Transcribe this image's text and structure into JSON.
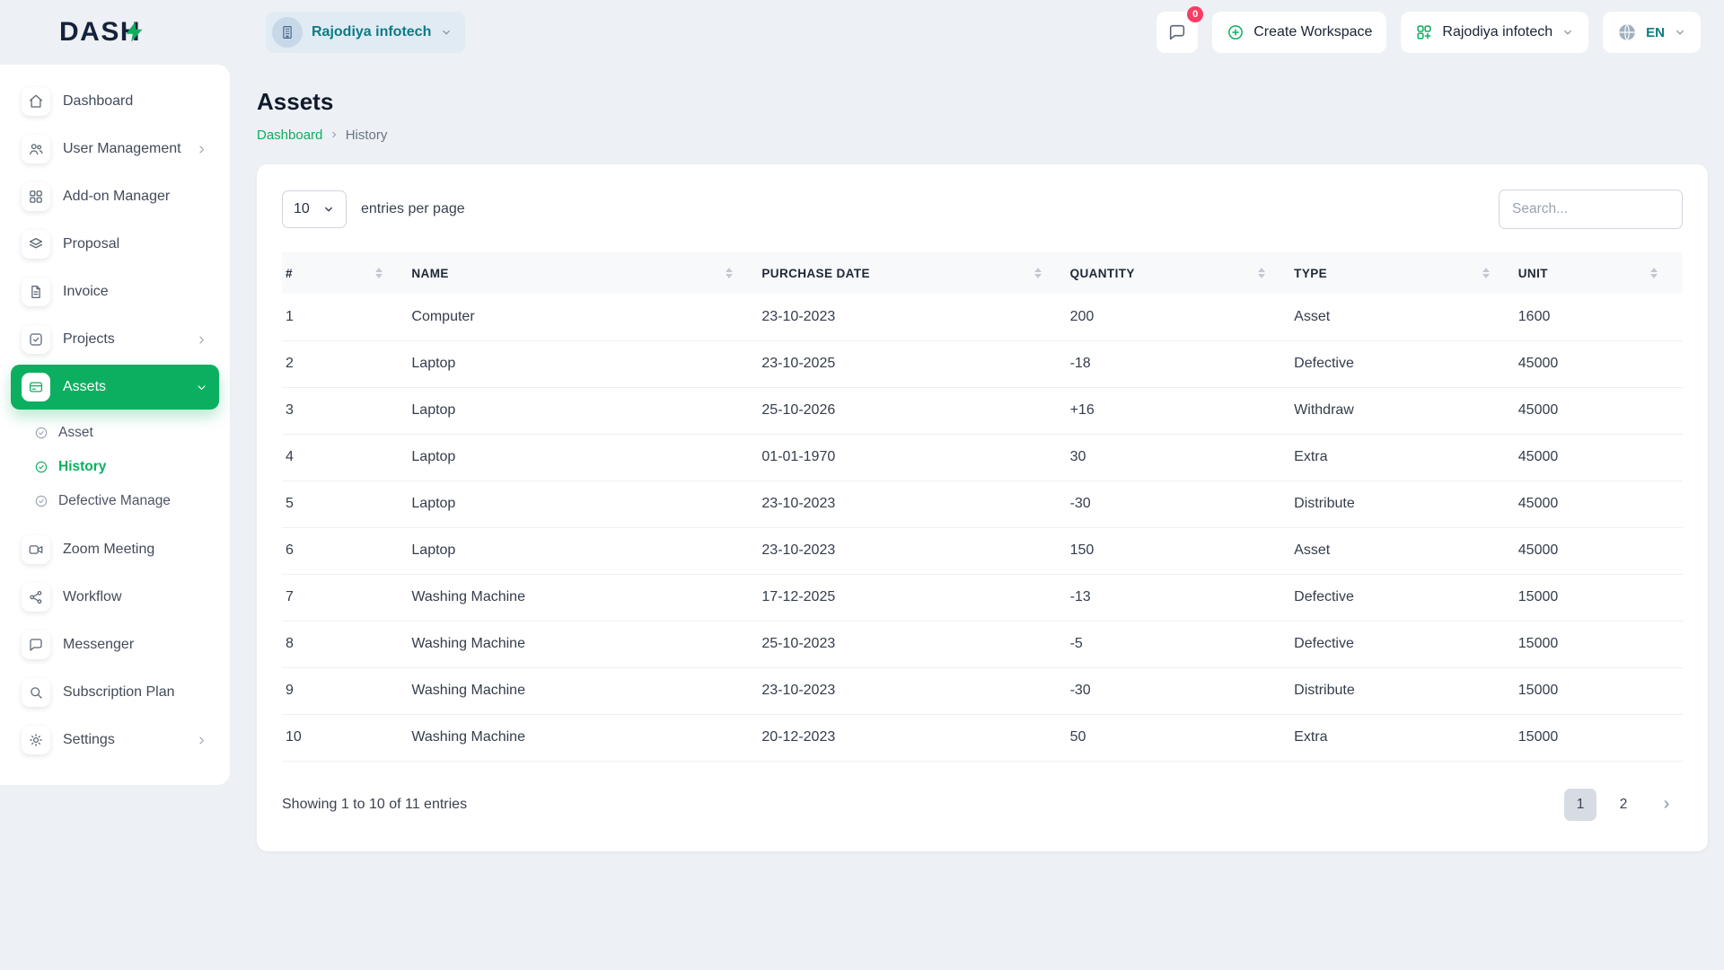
{
  "brand": {
    "name": "DASH"
  },
  "topbar": {
    "workspace_pill": "Rajodiya infotech",
    "chat_badge": "0",
    "create_workspace": "Create Workspace",
    "workspace_dropdown": "Rajodiya infotech",
    "language": "EN"
  },
  "sidebar": {
    "items": [
      {
        "label": "Dashboard",
        "icon": "home"
      },
      {
        "label": "User Management",
        "icon": "users",
        "chevron": true
      },
      {
        "label": "Add-on Manager",
        "icon": "grid"
      },
      {
        "label": "Proposal",
        "icon": "layers"
      },
      {
        "label": "Invoice",
        "icon": "file"
      },
      {
        "label": "Projects",
        "icon": "check-square",
        "chevron": true
      },
      {
        "label": "Assets",
        "icon": "credit-card",
        "active": true,
        "expanded": true,
        "children": [
          {
            "label": "Asset"
          },
          {
            "label": "History",
            "active": true
          },
          {
            "label": "Defective Manage"
          }
        ]
      },
      {
        "label": "Zoom Meeting",
        "icon": "video-camera"
      },
      {
        "label": "Workflow",
        "icon": "share-nodes"
      },
      {
        "label": "Messenger",
        "icon": "chat-bubble"
      },
      {
        "label": "Subscription Plan",
        "icon": "magnifier"
      },
      {
        "label": "Settings",
        "icon": "gear",
        "chevron": true
      }
    ]
  },
  "page": {
    "title": "Assets",
    "breadcrumb_root": "Dashboard",
    "breadcrumb_separator": "›",
    "breadcrumb_current": "History"
  },
  "controls": {
    "entries_value": "10",
    "entries_label": "entries per page",
    "search_placeholder": "Search..."
  },
  "table": {
    "columns": [
      "#",
      "NAME",
      "PURCHASE DATE",
      "QUANTITY",
      "TYPE",
      "UNIT"
    ],
    "rows": [
      [
        "1",
        "Computer",
        "23-10-2023",
        "200",
        "Asset",
        "1600"
      ],
      [
        "2",
        "Laptop",
        "23-10-2025",
        "-18",
        "Defective",
        "45000"
      ],
      [
        "3",
        "Laptop",
        "25-10-2026",
        "+16",
        "Withdraw",
        "45000"
      ],
      [
        "4",
        "Laptop",
        "01-01-1970",
        "30",
        "Extra",
        "45000"
      ],
      [
        "5",
        "Laptop",
        "23-10-2023",
        "-30",
        "Distribute",
        "45000"
      ],
      [
        "6",
        "Laptop",
        "23-10-2023",
        "150",
        "Asset",
        "45000"
      ],
      [
        "7",
        "Washing Machine",
        "17-12-2025",
        "-13",
        "Defective",
        "15000"
      ],
      [
        "8",
        "Washing Machine",
        "25-10-2023",
        "-5",
        "Defective",
        "15000"
      ],
      [
        "9",
        "Washing Machine",
        "23-10-2023",
        "-30",
        "Distribute",
        "15000"
      ],
      [
        "10",
        "Washing Machine",
        "20-12-2023",
        "50",
        "Extra",
        "15000"
      ]
    ],
    "summary": "Showing 1 to 10 of 11 entries",
    "pagination": {
      "pages": [
        "1",
        "2"
      ],
      "active": "1",
      "next": "›"
    }
  },
  "colors": {
    "primary": "#0caf60",
    "badge": "#fb3b64",
    "workspace_text": "#0c7b85"
  }
}
